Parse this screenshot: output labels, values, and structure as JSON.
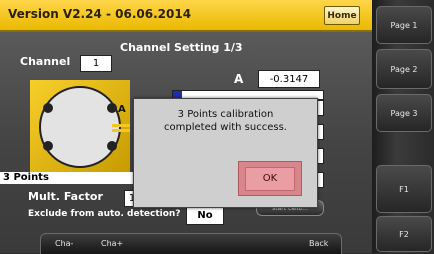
{
  "header": {
    "version": "Version V2.24 - 06.06.2014",
    "home_label": "Home"
  },
  "side_menu": [
    "Page 1",
    "Page 2",
    "Page 3",
    "F1",
    "F2"
  ],
  "screen": {
    "title": "Channel Setting 1/3",
    "channel_label": "Channel",
    "channel_value": "1",
    "measure_label": "A",
    "measure_value": "-0.3147",
    "probe_label": "A",
    "points_label": "3 Points",
    "mult_label": "Mult. Factor",
    "mult_value": "1",
    "exclude_label": "Exclude from auto. detection?",
    "exclude_value": "No",
    "partial_button_text": "start calib..."
  },
  "dialog": {
    "line1": "3 Points calibration",
    "line2": "completed with success.",
    "ok_label": "OK"
  },
  "tabs": [
    "Cha-",
    "Cha+",
    "Back"
  ],
  "colors": {
    "header_yellow": "#f2c81e",
    "dialog_bg": "#cfcfcf",
    "ok_highlight": "#e0959a"
  }
}
